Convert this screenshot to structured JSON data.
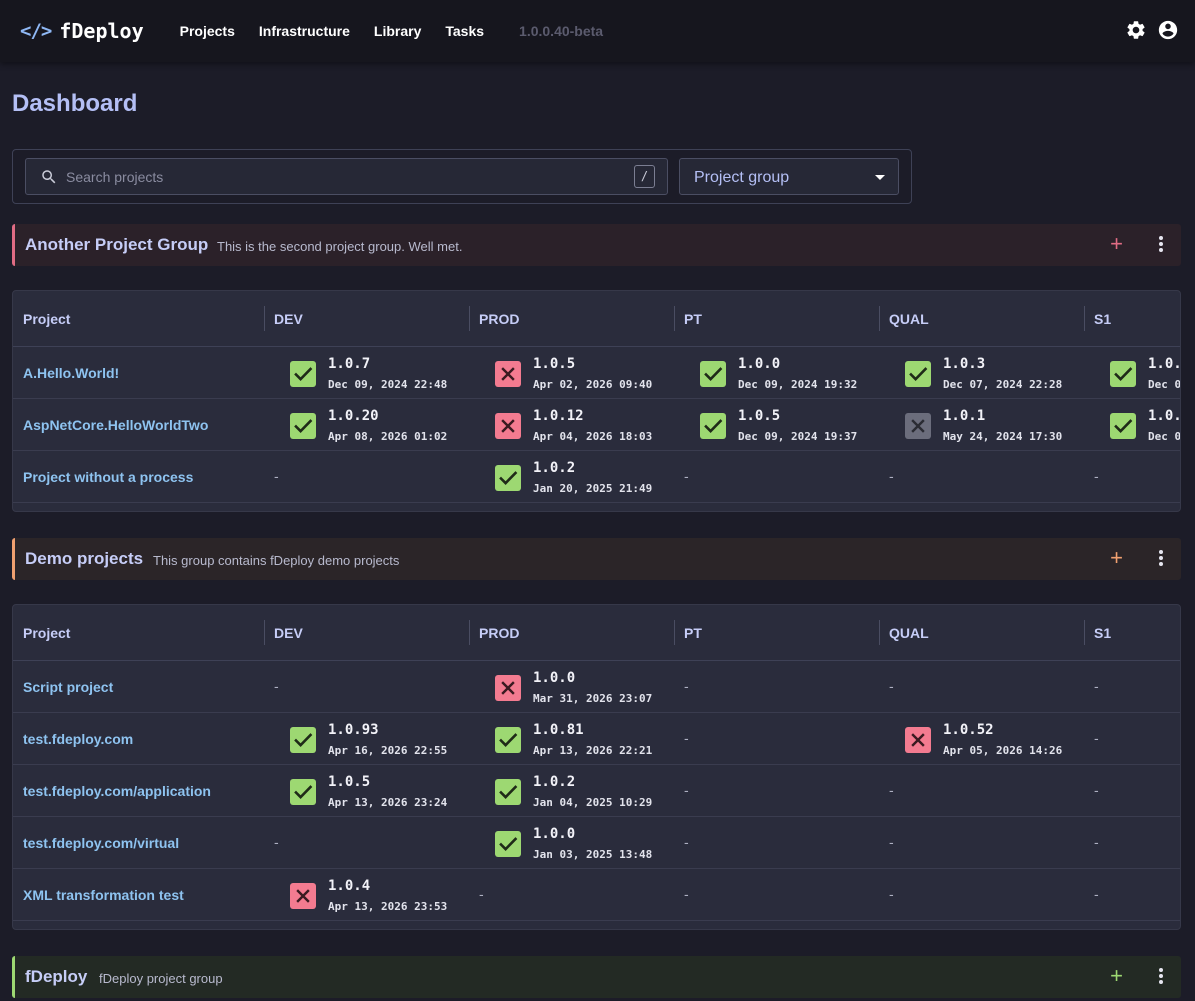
{
  "app": {
    "brand_icon": "</>",
    "brand": "fDeploy",
    "version": "1.0.0.40-beta"
  },
  "nav": [
    {
      "label": "Projects"
    },
    {
      "label": "Infrastructure"
    },
    {
      "label": "Library"
    },
    {
      "label": "Tasks"
    }
  ],
  "top_icons": [
    "gear-icon",
    "account-circle-icon"
  ],
  "page": {
    "title": "Dashboard"
  },
  "filters": {
    "search_placeholder": "Search projects",
    "search_shortcut": "/",
    "group_select": "Project group"
  },
  "columns": [
    "Project",
    "DEV",
    "PROD",
    "PT",
    "QUAL",
    "S1"
  ],
  "colors": {
    "success": "#9dd872",
    "failed": "#f37b90",
    "cancelled": "#6b6d7c",
    "link": "#8ec3f0",
    "heading": "#b4bff5"
  },
  "groups": [
    {
      "name": "Another Project Group",
      "description": "This is the second project group. Well met.",
      "accent": "#e06c84",
      "bg": "#2b2129",
      "projects": [
        {
          "name": "A.Hello.World!",
          "cells": [
            {
              "status": "success",
              "version": "1.0.7",
              "date": "Dec 09, 2024 22:48"
            },
            {
              "status": "failed",
              "version": "1.0.5",
              "date": "Apr 02, 2026 09:40"
            },
            {
              "status": "success",
              "version": "1.0.0",
              "date": "Dec 09, 2024 19:32"
            },
            {
              "status": "success",
              "version": "1.0.3",
              "date": "Dec 07, 2024 22:28"
            },
            {
              "status": "success",
              "version": "1.0.",
              "date": "Dec 0"
            }
          ]
        },
        {
          "name": "AspNetCore.HelloWorldTwo",
          "cells": [
            {
              "status": "success",
              "version": "1.0.20",
              "date": "Apr 08, 2026 01:02"
            },
            {
              "status": "failed",
              "version": "1.0.12",
              "date": "Apr 04, 2026 18:03"
            },
            {
              "status": "success",
              "version": "1.0.5",
              "date": "Dec 09, 2024 19:37"
            },
            {
              "status": "cancelled",
              "version": "1.0.1",
              "date": "May 24, 2024 17:30"
            },
            {
              "status": "success",
              "version": "1.0.",
              "date": "Dec 0"
            }
          ]
        },
        {
          "name": "Project without a process",
          "cells": [
            {
              "status": "none",
              "text": "-"
            },
            {
              "status": "success",
              "version": "1.0.2",
              "date": "Jan 20, 2025 21:49"
            },
            {
              "status": "none",
              "text": "-"
            },
            {
              "status": "none",
              "text": "-"
            },
            {
              "status": "none",
              "text": "-"
            }
          ]
        }
      ]
    },
    {
      "name": "Demo projects",
      "description": "This group contains fDeploy demo projects",
      "accent": "#f0a070",
      "bg": "#2b2528",
      "projects": [
        {
          "name": "Script project",
          "cells": [
            {
              "status": "none",
              "text": "-"
            },
            {
              "status": "failed",
              "version": "1.0.0",
              "date": "Mar 31, 2026 23:07"
            },
            {
              "status": "none",
              "text": "-"
            },
            {
              "status": "none",
              "text": "-"
            },
            {
              "status": "none",
              "text": "-"
            }
          ]
        },
        {
          "name": "test.fdeploy.com",
          "cells": [
            {
              "status": "success",
              "version": "1.0.93",
              "date": "Apr 16, 2026 22:55"
            },
            {
              "status": "success",
              "version": "1.0.81",
              "date": "Apr 13, 2026 22:21"
            },
            {
              "status": "none",
              "text": "-"
            },
            {
              "status": "failed",
              "version": "1.0.52",
              "date": "Apr 05, 2026 14:26"
            },
            {
              "status": "none",
              "text": "-"
            }
          ]
        },
        {
          "name": "test.fdeploy.com/application",
          "cells": [
            {
              "status": "success",
              "version": "1.0.5",
              "date": "Apr 13, 2026 23:24"
            },
            {
              "status": "success",
              "version": "1.0.2",
              "date": "Jan 04, 2025 10:29"
            },
            {
              "status": "none",
              "text": "-"
            },
            {
              "status": "none",
              "text": "-"
            },
            {
              "status": "none",
              "text": "-"
            }
          ]
        },
        {
          "name": "test.fdeploy.com/virtual",
          "cells": [
            {
              "status": "none",
              "text": "-"
            },
            {
              "status": "success",
              "version": "1.0.0",
              "date": "Jan 03, 2025 13:48"
            },
            {
              "status": "none",
              "text": "-"
            },
            {
              "status": "none",
              "text": "-"
            },
            {
              "status": "none",
              "text": "-"
            }
          ]
        },
        {
          "name": "XML transformation test",
          "cells": [
            {
              "status": "failed",
              "version": "1.0.4",
              "date": "Apr 13, 2026 23:53"
            },
            {
              "status": "none",
              "text": "-"
            },
            {
              "status": "none",
              "text": "-"
            },
            {
              "status": "none",
              "text": "-"
            },
            {
              "status": "none",
              "text": "-"
            }
          ]
        }
      ]
    },
    {
      "name": "fDeploy",
      "description": "fDeploy project group",
      "accent": "#9dd872",
      "bg": "#232a24",
      "projects": []
    }
  ]
}
